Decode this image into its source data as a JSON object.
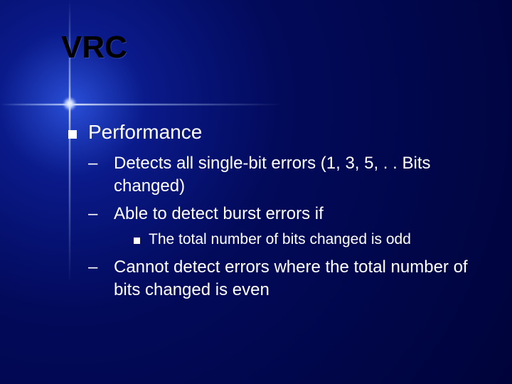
{
  "title": "VRC",
  "bullets": {
    "lvl1": "Performance",
    "lvl2a": "Detects all single-bit errors (1, 3, 5, . . Bits changed)",
    "lvl2b": "Able to detect burst errors if",
    "lvl3": "The total number of bits changed is odd",
    "lvl2c": "Cannot detect errors where the total number of bits changed is even"
  }
}
